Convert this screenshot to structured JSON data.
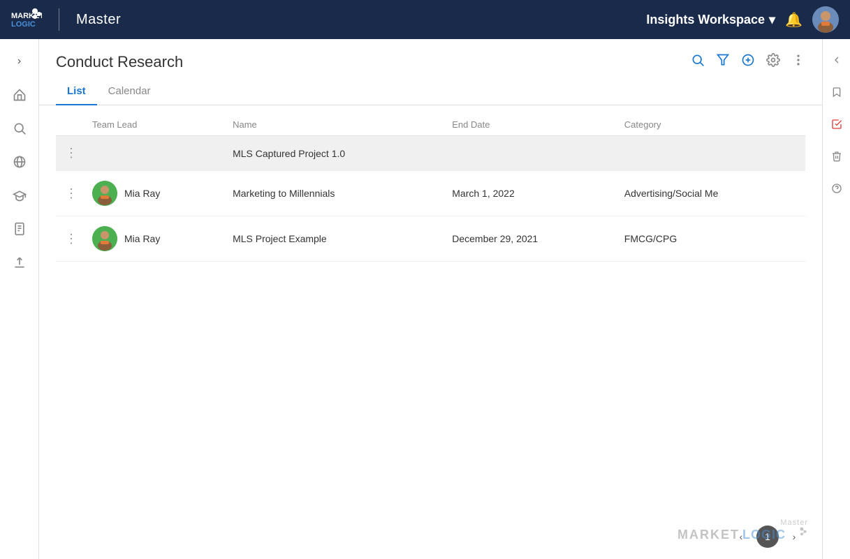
{
  "topnav": {
    "logo_alt": "MarketLogic",
    "master_label": "Master",
    "workspace_label": "Insights Workspace",
    "workspace_dropdown_icon": "▾"
  },
  "left_sidebar": {
    "chevron": "›",
    "icons": [
      "home",
      "search",
      "globe",
      "graduation",
      "document",
      "upload"
    ]
  },
  "right_sidebar": {
    "chevron": "‹",
    "icons": [
      "bookmark",
      "list-check",
      "trash",
      "help"
    ]
  },
  "page": {
    "title": "Conduct Research",
    "tabs": [
      {
        "label": "List",
        "active": true
      },
      {
        "label": "Calendar",
        "active": false
      }
    ],
    "header_icons": [
      "search",
      "filter",
      "add",
      "settings",
      "more"
    ]
  },
  "table": {
    "columns": [
      "",
      "Team Lead",
      "Name",
      "End Date",
      "Category"
    ],
    "rows": [
      {
        "menu": "⋮",
        "team_lead": null,
        "team_lead_avatar": null,
        "name": "MLS Captured Project 1.0",
        "end_date": "",
        "category": "",
        "highlighted": true
      },
      {
        "menu": "⋮",
        "team_lead": "Mia Ray",
        "team_lead_avatar": "mia",
        "name": "Marketing to Millennials",
        "end_date": "March 1, 2022",
        "category": "Advertising/Social Me",
        "highlighted": false
      },
      {
        "menu": "⋮",
        "team_lead": "Mia Ray",
        "team_lead_avatar": "mia",
        "name": "MLS Project Example",
        "end_date": "December 29, 2021",
        "category": "FMCG/CPG",
        "highlighted": false
      }
    ]
  },
  "pagination": {
    "prev": "‹",
    "next": "›",
    "current_page": 1,
    "pages": [
      1
    ]
  },
  "watermark": {
    "master": "Master",
    "market": "MARKET",
    "logic": "LOGIC"
  }
}
